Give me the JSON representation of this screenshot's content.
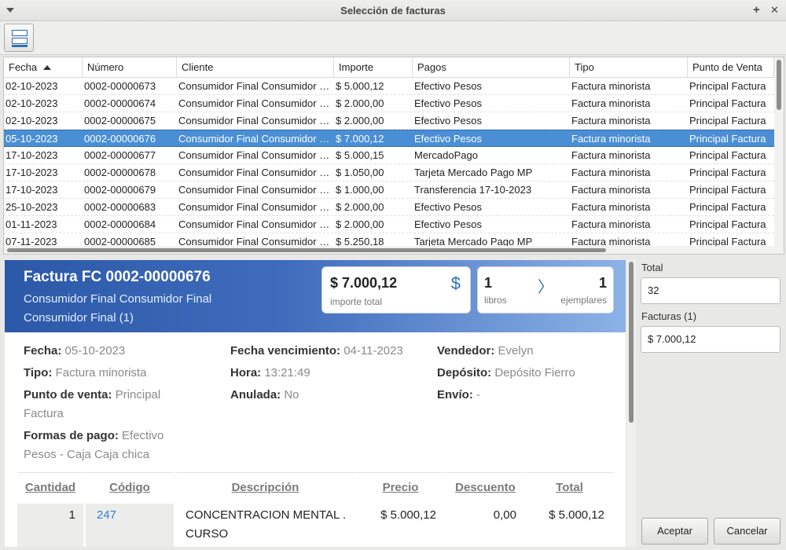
{
  "window": {
    "title": "Selección de facturas",
    "pin": "+",
    "close": "✕"
  },
  "table": {
    "columns": [
      "Fecha",
      "Número",
      "Cliente",
      "Importe",
      "Pagos",
      "Tipo",
      "Punto de Venta"
    ],
    "rows": [
      [
        "02-10-2023",
        "0002-00000673",
        "Consumidor Final Consumidor Final",
        "$ 5.000,12",
        "Efectivo Pesos",
        "Factura minorista",
        "Principal Factura"
      ],
      [
        "02-10-2023",
        "0002-00000674",
        "Consumidor Final Consumidor Final",
        "$ 2.000,00",
        "Efectivo Pesos",
        "Factura minorista",
        "Principal Factura"
      ],
      [
        "02-10-2023",
        "0002-00000675",
        "Consumidor Final Consumidor Final",
        "$ 2.000,00",
        "Efectivo Pesos",
        "Factura minorista",
        "Principal Factura"
      ],
      [
        "05-10-2023",
        "0002-00000676",
        "Consumidor Final Consumidor Final",
        "$ 7.000,12",
        "Efectivo Pesos",
        "Factura minorista",
        "Principal Factura"
      ],
      [
        "17-10-2023",
        "0002-00000677",
        "Consumidor Final Consumidor Final",
        "$ 5.000,15",
        "MercadoPago",
        "Factura minorista",
        "Principal Factura"
      ],
      [
        "17-10-2023",
        "0002-00000678",
        "Consumidor Final Consumidor Final",
        "$ 1.050,00",
        "Tarjeta Mercado Pago MP",
        "Factura minorista",
        "Principal Factura"
      ],
      [
        "17-10-2023",
        "0002-00000679",
        "Consumidor Final Consumidor Final",
        "$ 1.000,00",
        "Transferencia 17-10-2023",
        "Factura minorista",
        "Principal Factura"
      ],
      [
        "25-10-2023",
        "0002-00000683",
        "Consumidor Final Consumidor Final",
        "$ 2.000,00",
        "Efectivo Pesos",
        "Factura minorista",
        "Principal Factura"
      ],
      [
        "01-11-2023",
        "0002-00000684",
        "Consumidor Final Consumidor Final",
        "$ 2.000,00",
        "Efectivo Pesos",
        "Factura minorista",
        "Principal Factura"
      ],
      [
        "07-11-2023",
        "0002-00000685",
        "Consumidor Final Consumidor Final",
        "$ 5.250,18",
        "Tarjeta Mercado Pago MP",
        "Factura minorista",
        "Principal Factura"
      ]
    ]
  },
  "detail": {
    "title": "Factura FC 0002-00000676",
    "client_line1": "Consumidor Final Consumidor Final",
    "client_line2": "Consumidor Final (1)",
    "amount": "$ 7.000,12",
    "amount_symbol": "$",
    "amount_label": "importe total",
    "books": "1",
    "books_label": "libros",
    "copies": "1",
    "copies_label": "ejemplares",
    "fields": {
      "fecha_label": "Fecha:",
      "fecha": "05-10-2023",
      "tipo_label": "Tipo:",
      "tipo": "Factura minorista",
      "punto_label": "Punto de venta:",
      "punto": "Principal Factura",
      "formas_label": "Formas de pago:",
      "formas": "Efectivo Pesos - Caja Caja chica",
      "venc_label": "Fecha vencimiento:",
      "venc": "04-11-2023",
      "hora_label": "Hora:",
      "hora": "13:21:49",
      "anulada_label": "Anulada:",
      "anulada": "No",
      "vendedor_label": "Vendedor:",
      "vendedor": "Evelyn",
      "deposito_label": "Depósito:",
      "deposito": "Depósito Fierro",
      "envio_label": "Envío:",
      "envio": "-"
    },
    "items_header": [
      "Cantidad",
      "Código",
      "Descripción",
      "Precio",
      "Descuento",
      "Total"
    ],
    "items": [
      {
        "cantidad": "1",
        "codigo": "247",
        "descripcion": "CONCENTRACION MENTAL . CURSO",
        "precio": "$ 5.000,12",
        "descuento": "0,00",
        "total": "$ 5.000,12"
      }
    ]
  },
  "summary": {
    "total_label": "Total",
    "total_value": "32",
    "facturas_label": "Facturas (1)",
    "facturas_value": "$ 7.000,12"
  },
  "buttons": {
    "accept": "Aceptar",
    "cancel": "Cancelar"
  },
  "colors": {
    "selection": "#4a8fd6",
    "banner_start": "#2c58a8",
    "banner_end": "#8cb2e6",
    "link": "#2f7fd0"
  }
}
